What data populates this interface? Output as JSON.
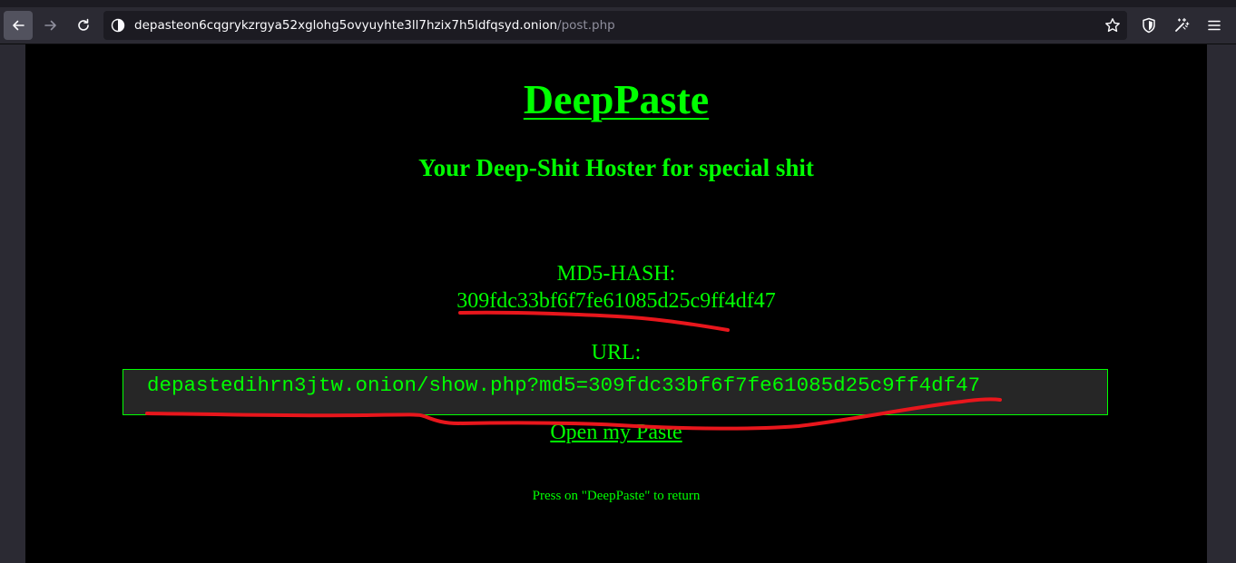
{
  "browser": {
    "url_host": "depasteon6cqgrykzrgya52xglohg5ovyuyhte3ll7hzix7h5ldfqsyd.onion",
    "url_path": "/post.php",
    "icons": [
      "back-arrow-icon",
      "forward-arrow-icon",
      "reload-icon",
      "page-info-icon",
      "bookmark-star-icon",
      "shield-icon",
      "magic-wand-icon",
      "menu-icon"
    ]
  },
  "page": {
    "title": "DeepPaste",
    "subtitle": "Your Deep-Shit Hoster for special shit",
    "hash_label": "MD5-HASH:",
    "hash_value": "309fdc33bf6f7fe61085d25c9ff4df47",
    "url_label": "URL:",
    "paste_url": "depastedihrn3jtw.onion/show.php?md5=309fdc33bf6f7fe61085d25c9ff4df47",
    "open_link": "Open my Paste",
    "return_note": "Press on \"DeepPaste\" to return"
  },
  "colors": {
    "page_text": "#00ff00",
    "page_bg": "#000000",
    "annotation": "#e8161c",
    "browser_chrome": "#2b2a33"
  }
}
